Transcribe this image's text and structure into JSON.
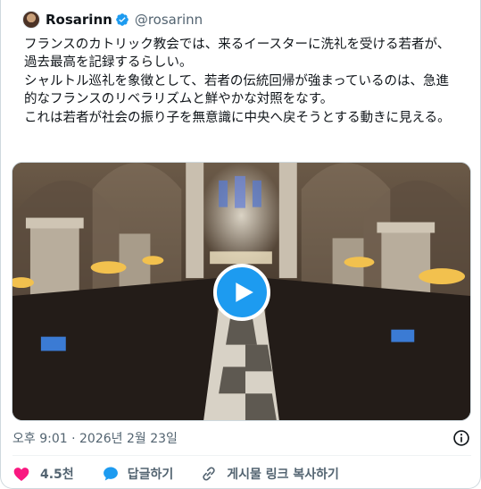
{
  "author": {
    "display_name": "Rosarinn",
    "handle": "@rosarinn",
    "avatar_icon": "avatar",
    "verified_icon": "verified-badge-icon",
    "verified_color": "#1d9bf0"
  },
  "tweet": {
    "text": "フランスのカトリック教会では、来るイースターに洗礼を受ける若者が、過去最高を記録するらしい。\nシャルトル巡礼を象徴として、若者の伝統回帰が強まっているのは、急進的なフランスのリベラリズムと鮮やかな対照をなす。\nこれは若者が社会の振り子を無意識に中央へ戻そうとする動きに見える。"
  },
  "media": {
    "type": "video",
    "play_icon": "play-icon",
    "play_color": "#1d9bf0"
  },
  "meta": {
    "timestamp": "오후 9:01 · 2026년 2월 23일",
    "info_icon": "info-icon"
  },
  "actions": {
    "like_count": "4.5천",
    "like_color": "#f91880",
    "reply_label": "답글하기",
    "reply_color": "#1d9bf0",
    "copy_label": "게시물 링크 복사하기"
  }
}
